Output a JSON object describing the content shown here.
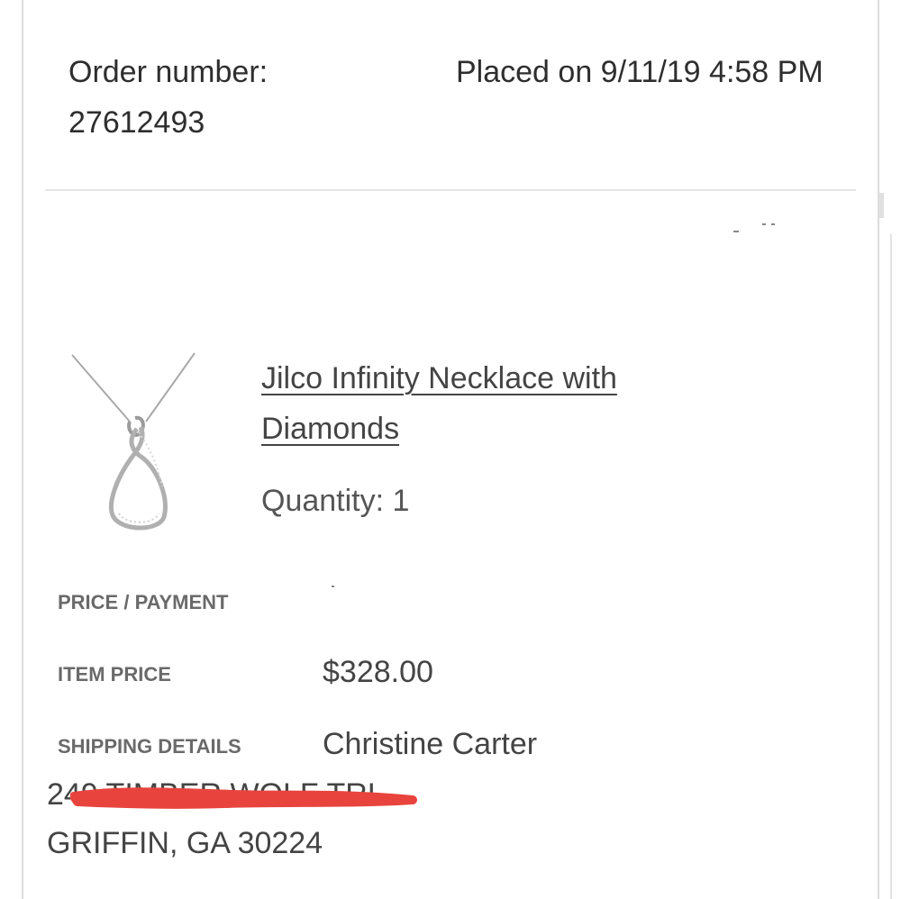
{
  "order": {
    "number_text": "Order number: 27612493",
    "placed_text": "Placed on 9/11/19 4:58 PM"
  },
  "product": {
    "image_icon": "infinity-necklace-image",
    "name": "Jilco Infinity Necklace with Diamonds",
    "quantity_label": "Quantity:",
    "quantity_value": "1"
  },
  "payment": {
    "heading": "PRICE / PAYMENT",
    "item_price_label": "ITEM PRICE",
    "item_price_value": "$328.00"
  },
  "shipping": {
    "label": "SHIPPING DETAILS",
    "name": "Christine Carter",
    "address_line1": "249 TIMBER WOLF TRL",
    "city_state_zip": "GRIFFIN, GA 30224",
    "redaction_color": "#e8443d"
  }
}
